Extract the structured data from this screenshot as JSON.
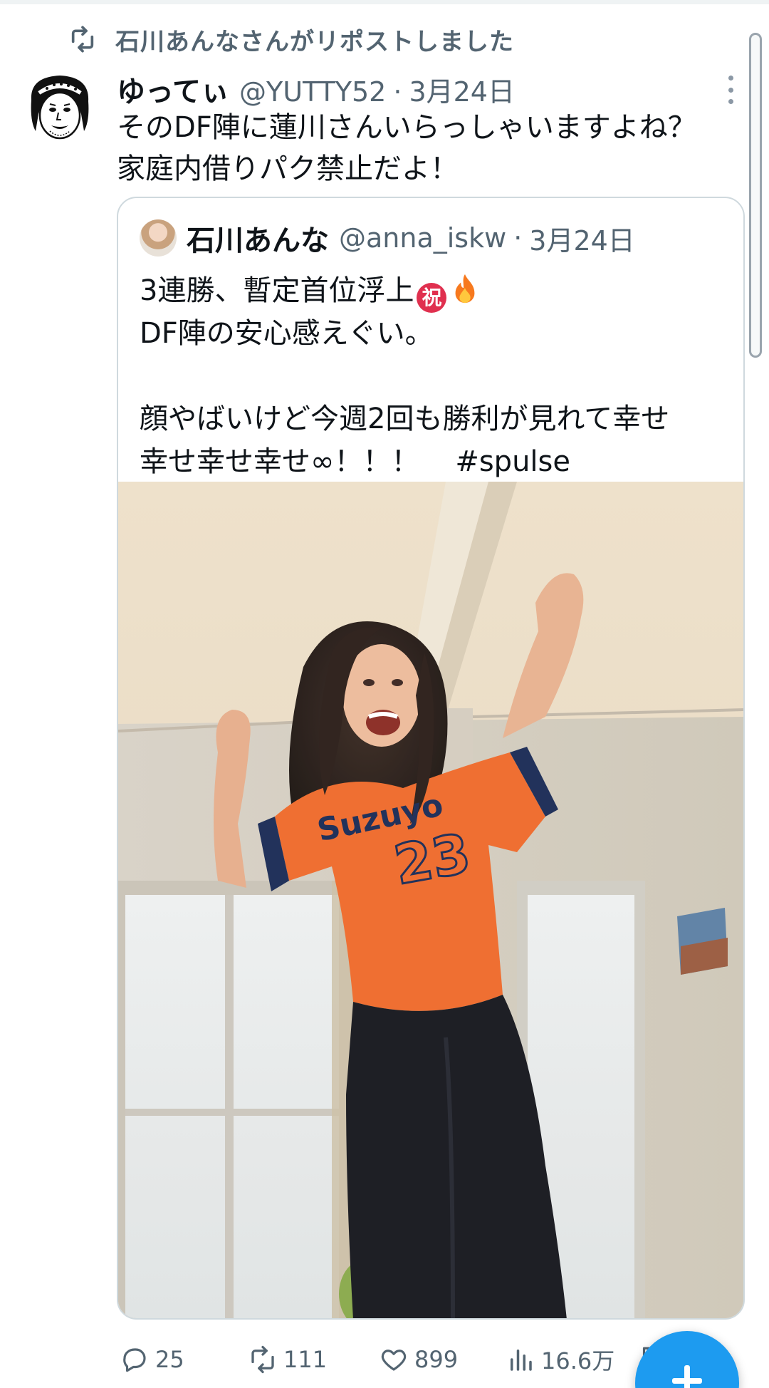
{
  "repost": {
    "text": "石川あんなさんがリポストしました",
    "icon": "repost-icon"
  },
  "tweet": {
    "display_name": "ゆってぃ",
    "handle": "@YUTTY52",
    "separator": "·",
    "date": "3月24日",
    "text": "そのDF陣に蓮川さんいらっしゃいますよね？\n家庭内借りパク禁止だよ！"
  },
  "quote": {
    "display_name": "石川あんな",
    "handle": "@anna_iskw",
    "separator": "·",
    "date": "3月24日",
    "line1": "3連勝、暫定首位浮上",
    "line1_badge": "祝",
    "line2": "DF陣の安心感えぐい。",
    "line3": "顔やばいけど今週2回も勝利が見れて幸せ",
    "line4": "幸せ幸せ幸せ∞！！！",
    "hashtag": "#spulse",
    "photo": {
      "jersey_brand": "Suzuyo",
      "jersey_number": "23"
    }
  },
  "actions": {
    "reply_count": "25",
    "repost_count": "111",
    "like_count": "899",
    "views_count": "16.6万"
  },
  "colors": {
    "accent": "#1d9bf0",
    "secondary_text": "#536471",
    "border": "#cfd9de",
    "jersey": "#ef6a2a"
  }
}
